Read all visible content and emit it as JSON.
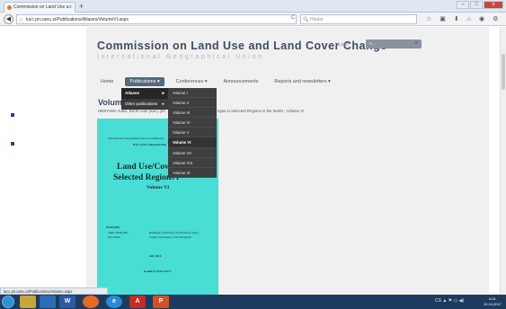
{
  "browser": {
    "tab_title": "Commission on Land Use a...",
    "tab_close": "×",
    "new_tab": "+",
    "window_buttons": {
      "minimize": "–",
      "maximize": "□",
      "close": "x"
    },
    "back_glyph": "◀",
    "info_glyph": "ⓘ",
    "url": "lucc.pri.sanu.si/Publications/Atlases/VolumeVI.aspx",
    "reload_glyph": "C",
    "search_placeholder": "Hledat",
    "search_glyph": "🔍",
    "toolbar_icons": [
      "☆",
      "▣",
      "⬇",
      "⌂",
      "◉",
      "⚙",
      "≡"
    ]
  },
  "site": {
    "title": "Commission on Land Use and Land Cover Change",
    "subtitle": "International Geographical Union",
    "login": "| Login",
    "search_placeholder": "e...",
    "search_glyph": "⌕"
  },
  "nav": {
    "items": [
      {
        "label": "Home"
      },
      {
        "label": "Publications ▾"
      },
      {
        "label": "Conferences ▾"
      },
      {
        "label": "Announcements"
      },
      {
        "label": "Reports and newsletters ▾"
      }
    ]
  },
  "content": {
    "title": "Volume",
    "byline_left": "HIMIYAMA Yukio, BICIK Ivan (eds.) (20",
    "byline_right": "nges in Selected Regions in the World - Volume VI"
  },
  "cover": {
    "line1": "International Geographical Union Commission",
    "line2": "IGU-LUCC Research Rep",
    "title_line1": "Land Use/Cover C",
    "title_line2": "Selected Regions i",
    "volume": "Volume VI",
    "editors_label": "EDITORS:",
    "editor1": "Yukio Himiyama",
    "editor1_affil": "Hokkaido University of Education, Japan",
    "editor2": "Ivan Bicik",
    "editor2_affil": "Charles University, Czech Republic",
    "date": "July 2011",
    "issued": "Issued by IGU-LUCC"
  },
  "dropdown_level1": [
    {
      "label": "Atlases",
      "arrow": "▸"
    },
    {
      "label": "Other publications",
      "arrow": "▸"
    }
  ],
  "dropdown_level2": [
    {
      "label": "Volume I"
    },
    {
      "label": "Volume II"
    },
    {
      "label": "Volume III"
    },
    {
      "label": "Volume IV"
    },
    {
      "label": "Volume V"
    },
    {
      "label": "Volume VI"
    },
    {
      "label": "Volume VII"
    },
    {
      "label": "Volume VIII"
    },
    {
      "label": "Volume IX"
    }
  ],
  "status_bar": "lucc.pri.sanu.si/Publications/Atlases.aspx",
  "taskbar": {
    "apps": [
      "W",
      "e",
      "A",
      "P"
    ],
    "tray": "CS  ▲ ⚑ ▭ ◀)",
    "time": "8:41",
    "date": "10.10.2017"
  },
  "colors": {
    "cover": "#48ddd5",
    "menu_active": "#56677e",
    "dropdown": "#3f3f3f",
    "taskbar": "#1d3b5e"
  }
}
